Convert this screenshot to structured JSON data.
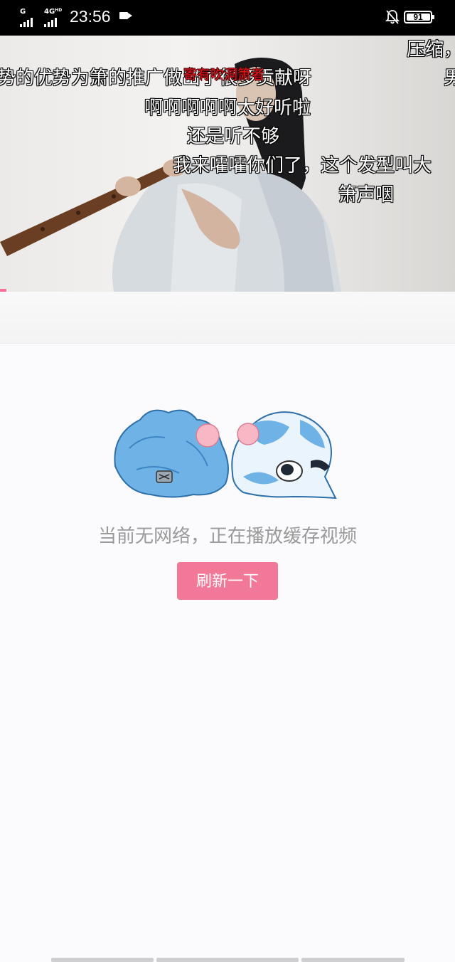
{
  "status_bar": {
    "network_left": "G",
    "network_right": "4G",
    "network_hd": "HD",
    "time": "23:56",
    "battery": "91"
  },
  "video": {
    "danmaku": [
      {
        "text": "压缩，"
      },
      {
        "text": "势的优势为箫的推广做出了很多贡献呀"
      },
      {
        "text": "寄有吹洞箫者"
      },
      {
        "text": "男"
      },
      {
        "text": "啊啊啊啊啊太好听啦"
      },
      {
        "text": "还是听不够"
      },
      {
        "text": "我来嚯嚯你们了，这个发型叫大"
      },
      {
        "text": "箫声咽"
      }
    ],
    "progress_percent": 1.4,
    "progress_color": "#fb7299"
  },
  "empty_state": {
    "message": "当前无网络，正在播放缓存视频",
    "refresh_label": "刷新一下",
    "accent": "#f27898"
  }
}
